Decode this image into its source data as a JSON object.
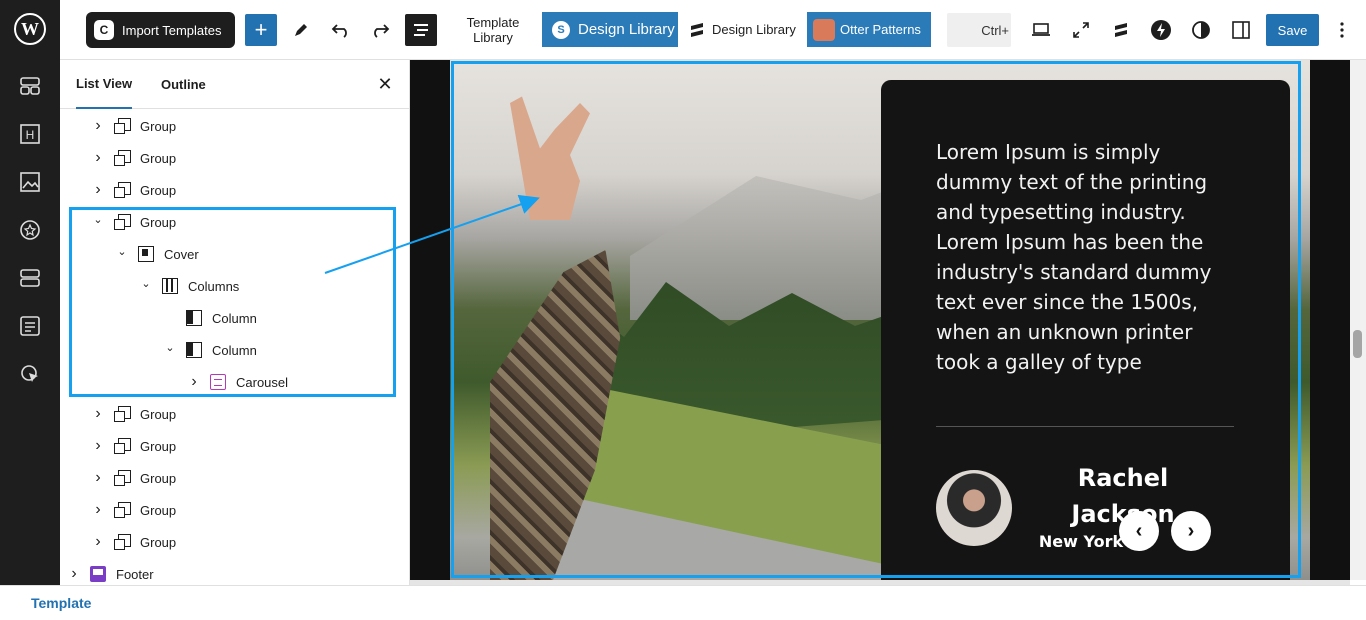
{
  "toolbar": {
    "import_label": "Import Templates",
    "template_library_label": "Template\nLibrary",
    "design_library_primary": "Design Library",
    "design_library_secondary": "Design Library",
    "otter_patterns": "Otter Patterns",
    "shortcut_hint": "Ctrl+",
    "save_label": "Save"
  },
  "panel": {
    "tabs": [
      "List View",
      "Outline"
    ],
    "items": [
      {
        "label": "Group",
        "depth": 0,
        "expanded": false,
        "icon": "group"
      },
      {
        "label": "Group",
        "depth": 0,
        "expanded": false,
        "icon": "group"
      },
      {
        "label": "Group",
        "depth": 0,
        "expanded": false,
        "icon": "group"
      },
      {
        "label": "Group",
        "depth": 0,
        "expanded": true,
        "icon": "group"
      },
      {
        "label": "Cover",
        "depth": 1,
        "expanded": true,
        "icon": "cover"
      },
      {
        "label": "Columns",
        "depth": 2,
        "expanded": true,
        "icon": "columns"
      },
      {
        "label": "Column",
        "depth": 3,
        "expanded": null,
        "icon": "column"
      },
      {
        "label": "Column",
        "depth": 3,
        "expanded": true,
        "icon": "column"
      },
      {
        "label": "Carousel",
        "depth": 4,
        "expanded": false,
        "icon": "carousel"
      },
      {
        "label": "Group",
        "depth": 0,
        "expanded": false,
        "icon": "group"
      },
      {
        "label": "Group",
        "depth": 0,
        "expanded": false,
        "icon": "group"
      },
      {
        "label": "Group",
        "depth": 0,
        "expanded": false,
        "icon": "group"
      },
      {
        "label": "Group",
        "depth": 0,
        "expanded": false,
        "icon": "group"
      },
      {
        "label": "Group",
        "depth": 0,
        "expanded": false,
        "icon": "group"
      },
      {
        "label": "Footer",
        "depth": -1,
        "expanded": false,
        "icon": "footer"
      }
    ]
  },
  "canvas": {
    "quote": "Lorem Ipsum is simply dummy text of the printing and typesetting industry. Lorem Ipsum has been the industry's standard dummy text ever since the 1500s, when an unknown printer took a galley of type",
    "name": "Rachel Jackson",
    "city": "New York"
  },
  "footer": {
    "breadcrumb": "Template"
  },
  "colors": {
    "accent": "#2271b1",
    "highlight": "#16a0f0",
    "card": "#141414"
  }
}
